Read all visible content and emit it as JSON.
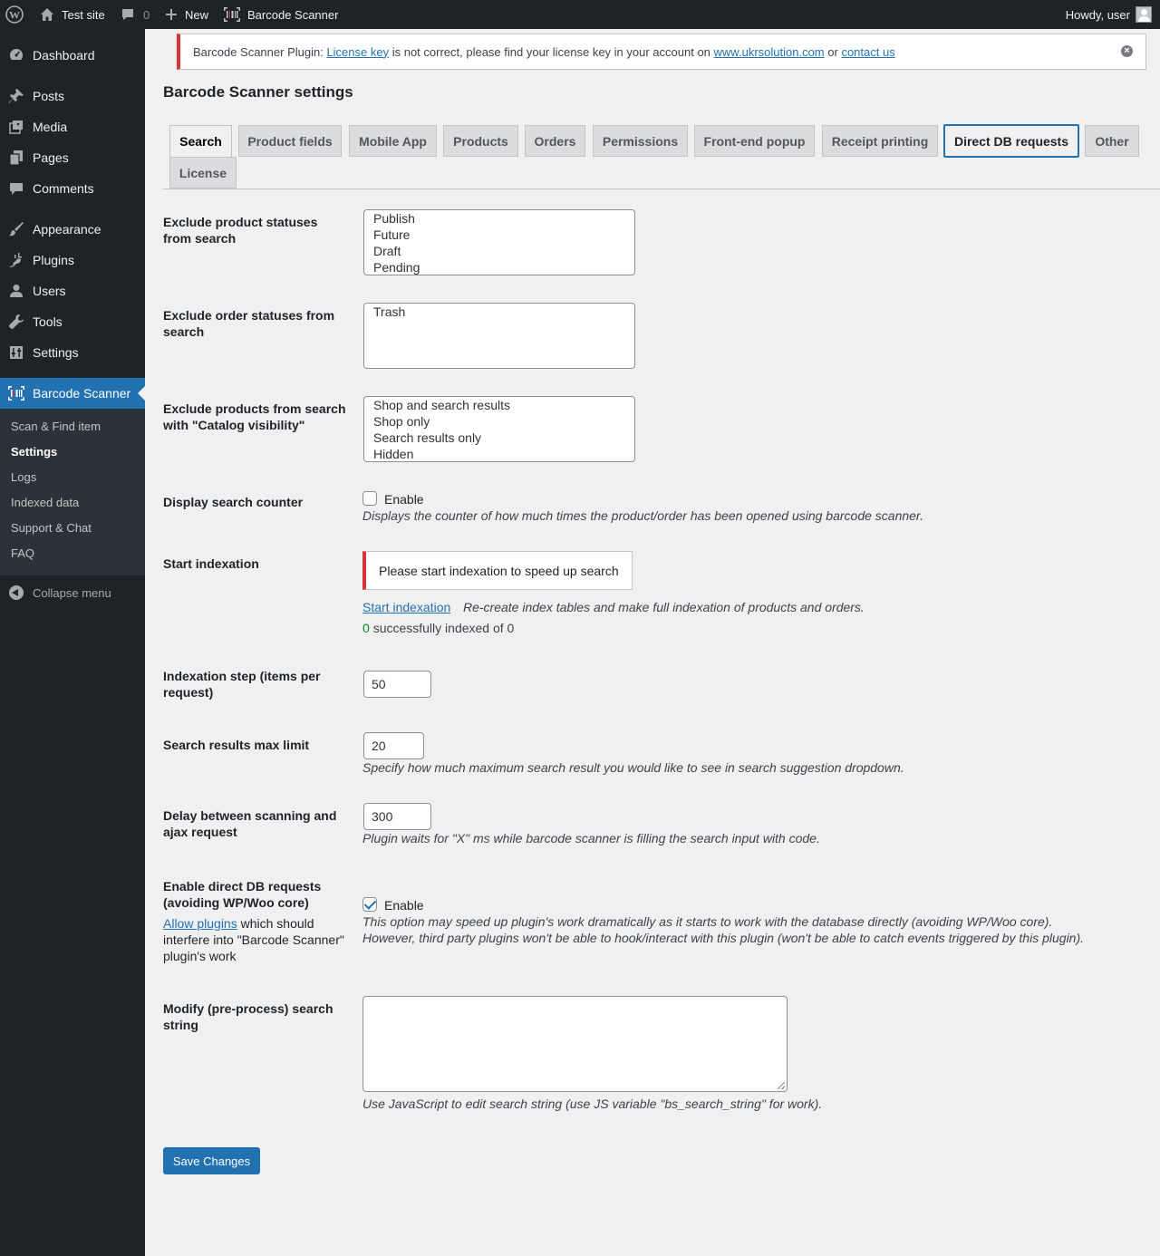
{
  "adminbar": {
    "site_name": "Test site",
    "comments_count": "0",
    "new_label": "New",
    "plugin_label": "Barcode Scanner",
    "howdy": "Howdy, user"
  },
  "sidebar": {
    "items": [
      {
        "label": "Dashboard",
        "icon": "dashboard-icon"
      },
      {
        "label": "Posts",
        "icon": "pin-icon"
      },
      {
        "label": "Media",
        "icon": "media-icon"
      },
      {
        "label": "Pages",
        "icon": "pages-icon"
      },
      {
        "label": "Comments",
        "icon": "comment-icon"
      },
      {
        "label": "Appearance",
        "icon": "brush-icon"
      },
      {
        "label": "Plugins",
        "icon": "plug-icon"
      },
      {
        "label": "Users",
        "icon": "user-icon"
      },
      {
        "label": "Tools",
        "icon": "wrench-icon"
      },
      {
        "label": "Settings",
        "icon": "settings-icon"
      },
      {
        "label": "Barcode Scanner",
        "icon": "barcode-icon"
      }
    ],
    "submenu": [
      "Scan & Find item",
      "Settings",
      "Logs",
      "Indexed data",
      "Support & Chat",
      "FAQ"
    ],
    "collapse_label": "Collapse menu"
  },
  "notice": {
    "prefix": "Barcode Scanner Plugin:",
    "link1": "License key",
    "middle": "is not correct, please find your license key in your account on",
    "link2": "www.ukrsolution.com",
    "or": "or",
    "link3": "contact us"
  },
  "page_title": "Barcode Scanner settings",
  "tabs": [
    "Search",
    "Product fields",
    "Mobile App",
    "Products",
    "Orders",
    "Permissions",
    "Front-end popup",
    "Receipt printing",
    "Direct DB requests",
    "Other",
    "License"
  ],
  "form": {
    "exclude_product_statuses": {
      "label": "Exclude product statuses from search",
      "options": [
        "Publish",
        "Future",
        "Draft",
        "Pending"
      ]
    },
    "exclude_order_statuses": {
      "label": "Exclude order statuses from search",
      "options": [
        "Trash"
      ]
    },
    "exclude_catalog_visibility": {
      "label": "Exclude products from search with \"Catalog visibility\"",
      "options": [
        "Shop and search results",
        "Shop only",
        "Search results only",
        "Hidden"
      ]
    },
    "display_search_counter": {
      "label": "Display search counter",
      "checkbox_label": "Enable",
      "checked": false,
      "description": "Displays the counter of how much times the product/order has been opened using barcode scanner."
    },
    "start_indexation": {
      "label": "Start indexation",
      "notice": "Please start indexation to speed up search",
      "link": "Start indexation",
      "description": "Re-create index tables and make full indexation of products and orders.",
      "indexed_count": "0",
      "indexed_text": "successfully indexed of 0"
    },
    "indexation_step": {
      "label": "Indexation step (items per request)",
      "value": "50"
    },
    "search_max_limit": {
      "label": "Search results max limit",
      "value": "20",
      "description": "Specify how much maximum search result you would like to see in search suggestion dropdown."
    },
    "delay": {
      "label": "Delay between scanning and ajax request",
      "value": "300",
      "description": "Plugin waits for \"X\" ms while barcode scanner is filling the search input with code."
    },
    "direct_db": {
      "label": "Enable direct DB requests (avoiding WP/Woo core)",
      "allow_link": "Allow plugins",
      "allow_text": "which should interfere into \"Barcode Scanner\" plugin's work",
      "checkbox_label": "Enable",
      "checked": true,
      "description_line1": "This option may speed up plugin's work dramatically as it starts to work with the database directly (avoiding WP/Woo core).",
      "description_line2": "However, third party plugins won't be able to hook/interact with this plugin (won't be able to catch events triggered by this plugin)."
    },
    "modify_search": {
      "label": "Modify (pre-process) search string",
      "value": "",
      "description": "Use JavaScript to edit search string (use JS variable \"bs_search_string\" for work)."
    }
  },
  "save_button": "Save Changes",
  "colors": {
    "admin_dark": "#1d2327",
    "accent": "#2271b1",
    "error": "#d63638",
    "success": "#008a20"
  }
}
